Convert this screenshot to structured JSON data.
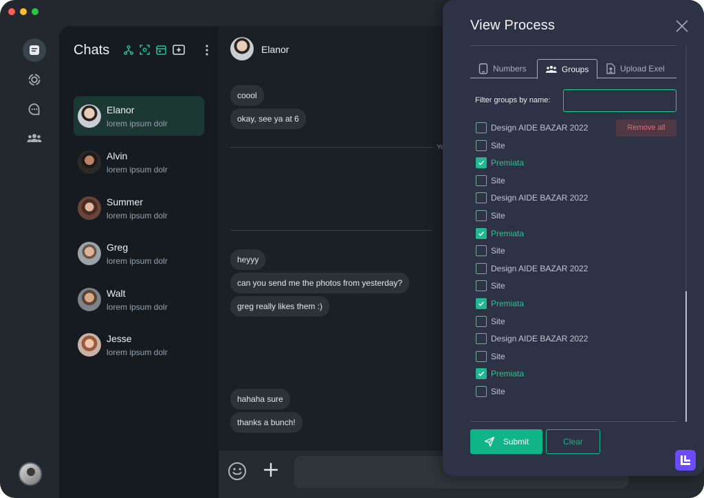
{
  "chats": {
    "title": "Chats",
    "contacts": [
      {
        "name": "Elanor",
        "preview": "lorem ipsum dolr"
      },
      {
        "name": "Alvin",
        "preview": "lorem ipsum dolr"
      },
      {
        "name": "Summer",
        "preview": "lorem ipsum dolr"
      },
      {
        "name": "Greg",
        "preview": "lorem ipsum dolr"
      },
      {
        "name": "Walt",
        "preview": "lorem ipsum dolr"
      },
      {
        "name": "Jesse",
        "preview": "lorem ipsum dolr"
      }
    ]
  },
  "conversation": {
    "contact_name": "Elanor",
    "messages": [
      "coool",
      "okay, see ya at 6",
      "heyyy",
      "can you send me the photos from yesterday?",
      "greg really likes them :)",
      "hahaha sure",
      "thanks a bunch!"
    ],
    "divider_label": "Ye"
  },
  "modal": {
    "title": "View Process",
    "tabs": [
      {
        "label": "Numbers",
        "icon": "phone-icon"
      },
      {
        "label": "Groups",
        "icon": "group-icon"
      },
      {
        "label": "Upload Exel",
        "icon": "upload-file-icon"
      }
    ],
    "active_tab": "Groups",
    "filter_label": "Filter groups by name:",
    "filter_value": "",
    "remove_all_label": "Remove all",
    "groups": [
      {
        "label": "Design AIDE BAZAR 2022",
        "checked": false
      },
      {
        "label": "Site",
        "checked": false
      },
      {
        "label": "Premiata",
        "checked": true
      },
      {
        "label": "Site",
        "checked": false
      },
      {
        "label": "Design AIDE BAZAR 2022",
        "checked": false
      },
      {
        "label": "Site",
        "checked": false
      },
      {
        "label": "Premiata",
        "checked": true
      },
      {
        "label": "Site",
        "checked": false
      },
      {
        "label": "Design AIDE BAZAR 2022",
        "checked": false
      },
      {
        "label": "Site",
        "checked": false
      },
      {
        "label": "Premiata",
        "checked": true
      },
      {
        "label": "Site",
        "checked": false
      },
      {
        "label": "Design AIDE BAZAR 2022",
        "checked": false
      },
      {
        "label": "Site",
        "checked": false
      },
      {
        "label": "Premiata",
        "checked": true
      },
      {
        "label": "Site",
        "checked": false
      }
    ],
    "submit_label": "Submit",
    "clear_label": "Clear"
  },
  "colors": {
    "accent": "#11b488",
    "danger": "#e36d73",
    "modal_bg": "#2d3244",
    "brand": "#6c4cff"
  }
}
